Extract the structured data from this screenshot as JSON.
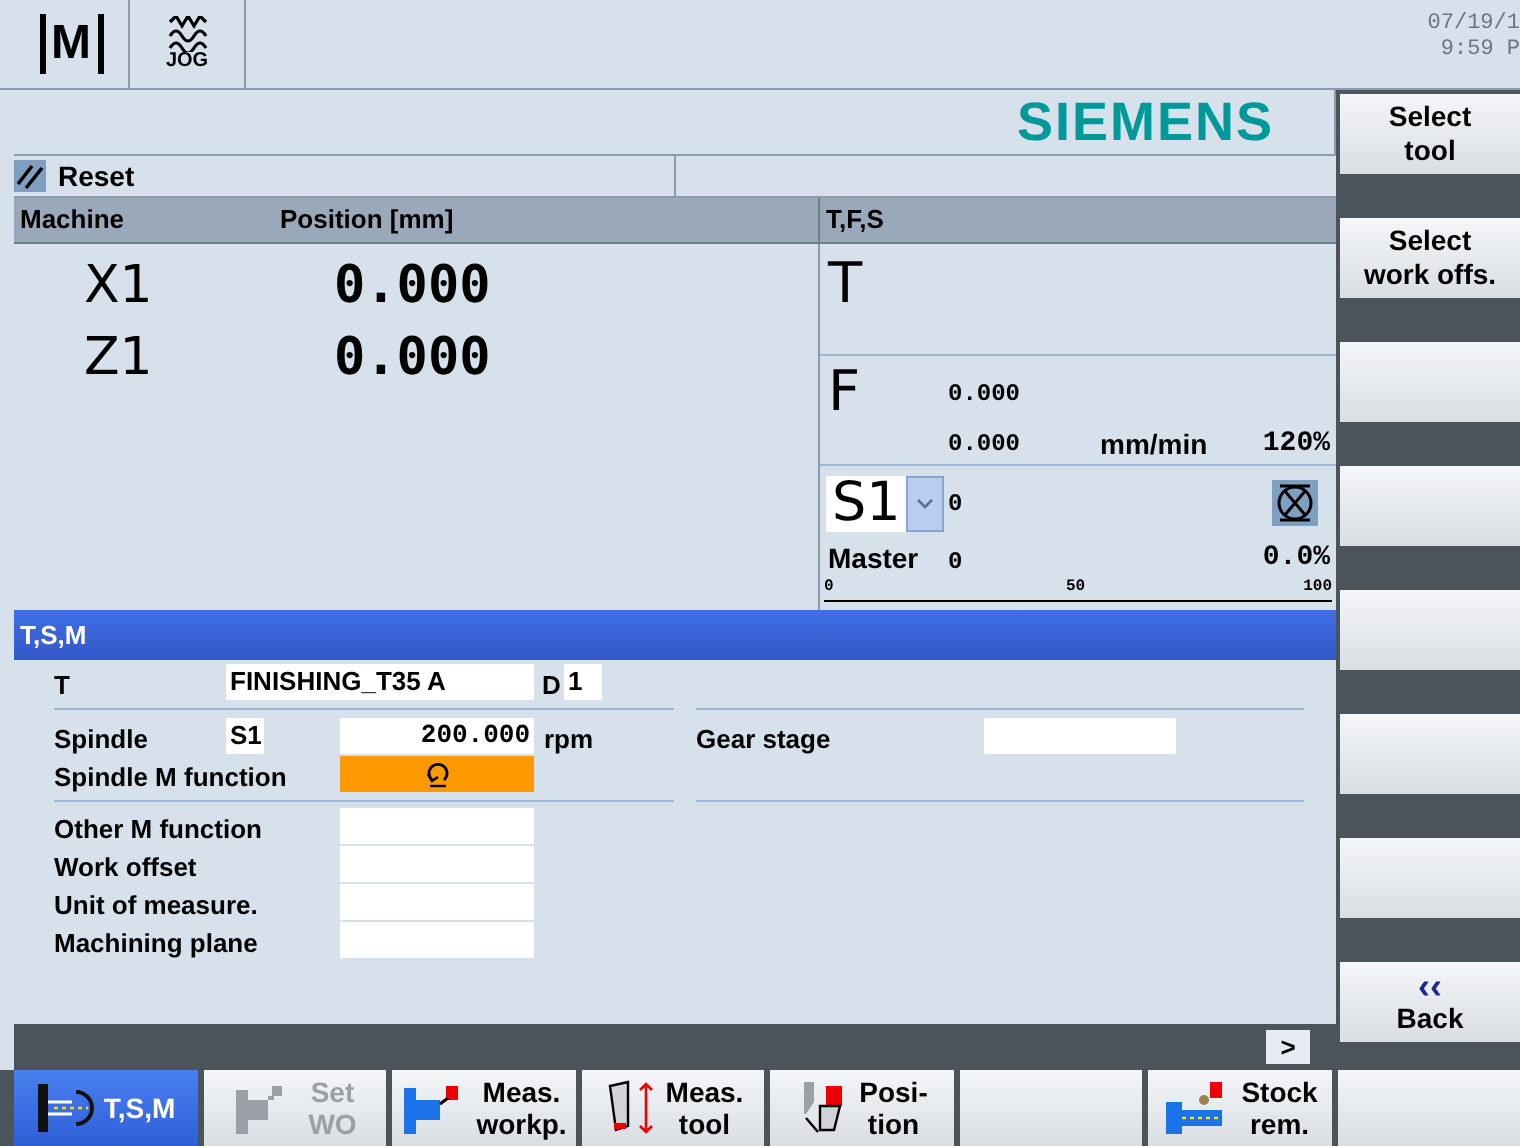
{
  "header": {
    "mode_letter": "M",
    "mode_label": "JOG",
    "date": "07/19/1",
    "time": "9:59 P",
    "logo": "SIEMENS"
  },
  "status": {
    "reset": "Reset"
  },
  "position": {
    "columns": [
      "Machine",
      "Position [mm]"
    ],
    "axes": [
      {
        "name": "X1",
        "value": "0.000"
      },
      {
        "name": "Z1",
        "value": "0.000"
      }
    ]
  },
  "tfs": {
    "title": "T,F,S",
    "t_label": "T",
    "f_label": "F",
    "feed_actual": "0.000",
    "feed_set": "0.000",
    "feed_unit": "mm/min",
    "feed_override": "120%",
    "spindle": "S1",
    "spindle_speed": "0",
    "spindle_role": "Master",
    "spindle_load": "0",
    "spindle_override": "0.0%",
    "scale_ticks": [
      "0",
      "50",
      "100"
    ]
  },
  "tsm": {
    "title": "T,S,M",
    "tool_label": "T",
    "tool": "FINISHING_T35 A",
    "d_label": "D",
    "d_value": "1",
    "spindle_label": "Spindle",
    "spindle": "S1",
    "speed": "200.000",
    "speed_unit": "rpm",
    "m_function_label": "Spindle M function",
    "gear_label": "Gear stage",
    "fields": [
      {
        "label": "Other M function"
      },
      {
        "label": "Work offset"
      },
      {
        "label": "Unit of measure."
      },
      {
        "label": "Machining plane"
      }
    ]
  },
  "more_button": ">",
  "softkeys_right": [
    {
      "kind": "label",
      "lines": [
        "Select",
        "tool"
      ]
    },
    {
      "kind": "label",
      "lines": [
        "Select",
        "work offs."
      ]
    },
    {
      "kind": "blank"
    },
    {
      "kind": "blank"
    },
    {
      "kind": "blank"
    },
    {
      "kind": "blank"
    },
    {
      "kind": "blank"
    },
    {
      "kind": "back",
      "symbol": "‹‹",
      "lines": [
        "Back"
      ]
    }
  ],
  "softkeys_bottom": [
    {
      "kind": "tsm",
      "lines": [
        "T,S,M"
      ],
      "selected": true,
      "disabled": false
    },
    {
      "kind": "setwo",
      "lines": [
        "Set",
        "WO"
      ],
      "selected": false,
      "disabled": true
    },
    {
      "kind": "measworkp",
      "lines": [
        "Meas.",
        "workp."
      ],
      "selected": false,
      "disabled": false
    },
    {
      "kind": "meastool",
      "lines": [
        "Meas.",
        "tool"
      ],
      "selected": false,
      "disabled": false
    },
    {
      "kind": "position",
      "lines": [
        "Posi-",
        "tion"
      ],
      "selected": false,
      "disabled": false
    },
    {
      "kind": "blank",
      "selected": false
    },
    {
      "kind": "stock",
      "lines": [
        "Stock",
        "rem."
      ],
      "selected": false,
      "disabled": false
    },
    {
      "kind": "blank",
      "selected": false
    }
  ]
}
